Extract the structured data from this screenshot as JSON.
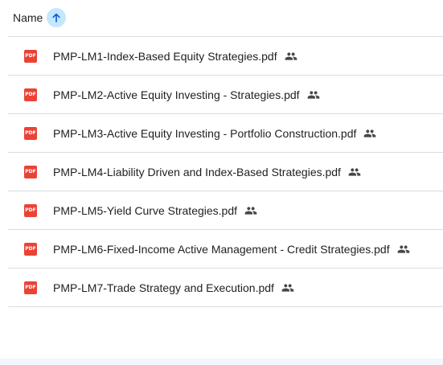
{
  "header": {
    "name_label": "Name",
    "sort_icon": "arrow-up-icon",
    "sort_direction": "ascending"
  },
  "files": [
    {
      "name": "PMP-LM1-Index-Based Equity Strategies.pdf",
      "type_badge": "PDF",
      "icon": "pdf-icon",
      "shared_icon": "people-icon"
    },
    {
      "name": "PMP-LM2-Active Equity Investing - Strategies.pdf",
      "type_badge": "PDF",
      "icon": "pdf-icon",
      "shared_icon": "people-icon"
    },
    {
      "name": "PMP-LM3-Active Equity Investing - Portfolio Construction.pdf",
      "type_badge": "PDF",
      "icon": "pdf-icon",
      "shared_icon": "people-icon"
    },
    {
      "name": "PMP-LM4-Liability Driven and Index-Based Strategies.pdf",
      "type_badge": "PDF",
      "icon": "pdf-icon",
      "shared_icon": "people-icon"
    },
    {
      "name": "PMP-LM5-Yield Curve Strategies.pdf",
      "type_badge": "PDF",
      "icon": "pdf-icon",
      "shared_icon": "people-icon"
    },
    {
      "name": "PMP-LM6-Fixed-Income Active Management - Credit Strategies.pdf",
      "type_badge": "PDF",
      "icon": "pdf-icon",
      "shared_icon": "people-icon"
    },
    {
      "name": "PMP-LM7-Trade Strategy and Execution.pdf",
      "type_badge": "PDF",
      "icon": "pdf-icon",
      "shared_icon": "people-icon"
    }
  ],
  "colors": {
    "pdf_red": "#ea4335",
    "sort_highlight": "#c2e7ff",
    "divider": "#dadce0",
    "text": "#1f1f1f"
  }
}
